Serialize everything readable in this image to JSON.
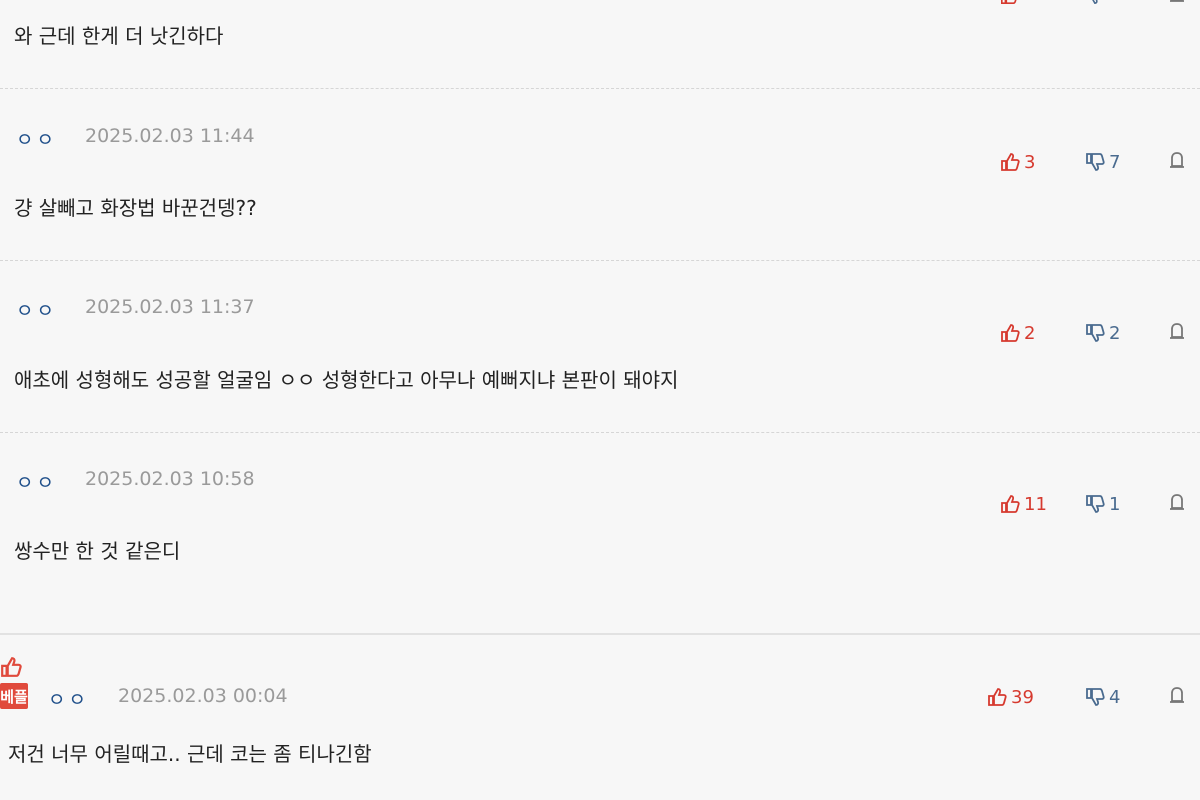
{
  "comments": [
    {
      "author": "",
      "date": "",
      "text": "와 근데 한게 더 낫긴하다",
      "likes": "",
      "dislikes": ""
    },
    {
      "author": "ㅇㅇ",
      "date": "2025.02.03 11:44",
      "text": "걍 살빼고 화장법 바꾼건뎅??",
      "likes": "3",
      "dislikes": "7"
    },
    {
      "author": "ㅇㅇ",
      "date": "2025.02.03 11:37",
      "text": "애초에 성형해도 성공할 얼굴임 ㅇㅇ 성형한다고 아무나 예뻐지냐 본판이 돼야지",
      "likes": "2",
      "dislikes": "2"
    },
    {
      "author": "ㅇㅇ",
      "date": "2025.02.03 10:58",
      "text": "쌍수만 한 것 같은디",
      "likes": "11",
      "dislikes": "1"
    },
    {
      "author": "ㅇㅇ",
      "date": "2025.02.03 00:04",
      "text": "저건 너무 어릴때고.. 근데 코는 좀 티나긴함",
      "likes": "39",
      "dislikes": "4",
      "badge": "베플"
    }
  ],
  "colors": {
    "like": "#d63a2f",
    "dislike": "#4a6b8f",
    "author": "#1f4f8a",
    "date": "#9a9a9a",
    "badge": "#e04a3c"
  },
  "icons": {
    "like": "thumbs-up-icon",
    "dislike": "thumbs-down-icon",
    "report": "report-icon"
  }
}
